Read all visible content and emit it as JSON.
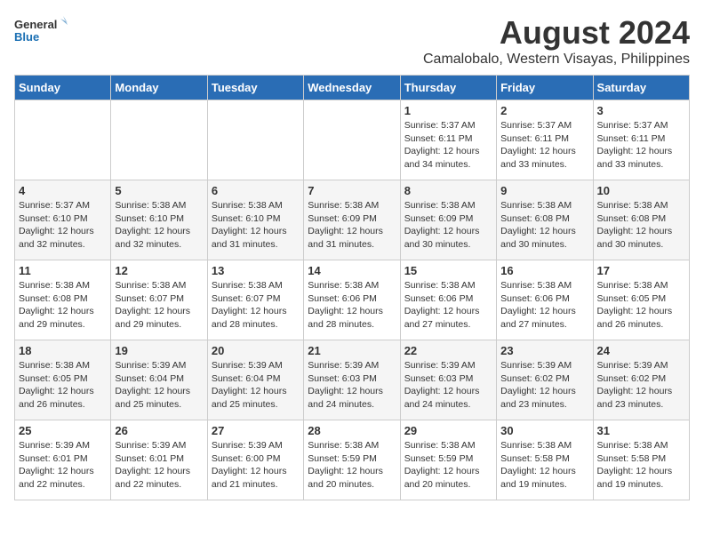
{
  "header": {
    "logo_general": "General",
    "logo_blue": "Blue",
    "month_year": "August 2024",
    "location": "Camalobalo, Western Visayas, Philippines"
  },
  "days_of_week": [
    "Sunday",
    "Monday",
    "Tuesday",
    "Wednesday",
    "Thursday",
    "Friday",
    "Saturday"
  ],
  "weeks": [
    [
      {
        "day": "",
        "info": ""
      },
      {
        "day": "",
        "info": ""
      },
      {
        "day": "",
        "info": ""
      },
      {
        "day": "",
        "info": ""
      },
      {
        "day": "1",
        "info": "Sunrise: 5:37 AM\nSunset: 6:11 PM\nDaylight: 12 hours\nand 34 minutes."
      },
      {
        "day": "2",
        "info": "Sunrise: 5:37 AM\nSunset: 6:11 PM\nDaylight: 12 hours\nand 33 minutes."
      },
      {
        "day": "3",
        "info": "Sunrise: 5:37 AM\nSunset: 6:11 PM\nDaylight: 12 hours\nand 33 minutes."
      }
    ],
    [
      {
        "day": "4",
        "info": "Sunrise: 5:37 AM\nSunset: 6:10 PM\nDaylight: 12 hours\nand 32 minutes."
      },
      {
        "day": "5",
        "info": "Sunrise: 5:38 AM\nSunset: 6:10 PM\nDaylight: 12 hours\nand 32 minutes."
      },
      {
        "day": "6",
        "info": "Sunrise: 5:38 AM\nSunset: 6:10 PM\nDaylight: 12 hours\nand 31 minutes."
      },
      {
        "day": "7",
        "info": "Sunrise: 5:38 AM\nSunset: 6:09 PM\nDaylight: 12 hours\nand 31 minutes."
      },
      {
        "day": "8",
        "info": "Sunrise: 5:38 AM\nSunset: 6:09 PM\nDaylight: 12 hours\nand 30 minutes."
      },
      {
        "day": "9",
        "info": "Sunrise: 5:38 AM\nSunset: 6:08 PM\nDaylight: 12 hours\nand 30 minutes."
      },
      {
        "day": "10",
        "info": "Sunrise: 5:38 AM\nSunset: 6:08 PM\nDaylight: 12 hours\nand 30 minutes."
      }
    ],
    [
      {
        "day": "11",
        "info": "Sunrise: 5:38 AM\nSunset: 6:08 PM\nDaylight: 12 hours\nand 29 minutes."
      },
      {
        "day": "12",
        "info": "Sunrise: 5:38 AM\nSunset: 6:07 PM\nDaylight: 12 hours\nand 29 minutes."
      },
      {
        "day": "13",
        "info": "Sunrise: 5:38 AM\nSunset: 6:07 PM\nDaylight: 12 hours\nand 28 minutes."
      },
      {
        "day": "14",
        "info": "Sunrise: 5:38 AM\nSunset: 6:06 PM\nDaylight: 12 hours\nand 28 minutes."
      },
      {
        "day": "15",
        "info": "Sunrise: 5:38 AM\nSunset: 6:06 PM\nDaylight: 12 hours\nand 27 minutes."
      },
      {
        "day": "16",
        "info": "Sunrise: 5:38 AM\nSunset: 6:06 PM\nDaylight: 12 hours\nand 27 minutes."
      },
      {
        "day": "17",
        "info": "Sunrise: 5:38 AM\nSunset: 6:05 PM\nDaylight: 12 hours\nand 26 minutes."
      }
    ],
    [
      {
        "day": "18",
        "info": "Sunrise: 5:38 AM\nSunset: 6:05 PM\nDaylight: 12 hours\nand 26 minutes."
      },
      {
        "day": "19",
        "info": "Sunrise: 5:39 AM\nSunset: 6:04 PM\nDaylight: 12 hours\nand 25 minutes."
      },
      {
        "day": "20",
        "info": "Sunrise: 5:39 AM\nSunset: 6:04 PM\nDaylight: 12 hours\nand 25 minutes."
      },
      {
        "day": "21",
        "info": "Sunrise: 5:39 AM\nSunset: 6:03 PM\nDaylight: 12 hours\nand 24 minutes."
      },
      {
        "day": "22",
        "info": "Sunrise: 5:39 AM\nSunset: 6:03 PM\nDaylight: 12 hours\nand 24 minutes."
      },
      {
        "day": "23",
        "info": "Sunrise: 5:39 AM\nSunset: 6:02 PM\nDaylight: 12 hours\nand 23 minutes."
      },
      {
        "day": "24",
        "info": "Sunrise: 5:39 AM\nSunset: 6:02 PM\nDaylight: 12 hours\nand 23 minutes."
      }
    ],
    [
      {
        "day": "25",
        "info": "Sunrise: 5:39 AM\nSunset: 6:01 PM\nDaylight: 12 hours\nand 22 minutes."
      },
      {
        "day": "26",
        "info": "Sunrise: 5:39 AM\nSunset: 6:01 PM\nDaylight: 12 hours\nand 22 minutes."
      },
      {
        "day": "27",
        "info": "Sunrise: 5:39 AM\nSunset: 6:00 PM\nDaylight: 12 hours\nand 21 minutes."
      },
      {
        "day": "28",
        "info": "Sunrise: 5:38 AM\nSunset: 5:59 PM\nDaylight: 12 hours\nand 20 minutes."
      },
      {
        "day": "29",
        "info": "Sunrise: 5:38 AM\nSunset: 5:59 PM\nDaylight: 12 hours\nand 20 minutes."
      },
      {
        "day": "30",
        "info": "Sunrise: 5:38 AM\nSunset: 5:58 PM\nDaylight: 12 hours\nand 19 minutes."
      },
      {
        "day": "31",
        "info": "Sunrise: 5:38 AM\nSunset: 5:58 PM\nDaylight: 12 hours\nand 19 minutes."
      }
    ]
  ]
}
